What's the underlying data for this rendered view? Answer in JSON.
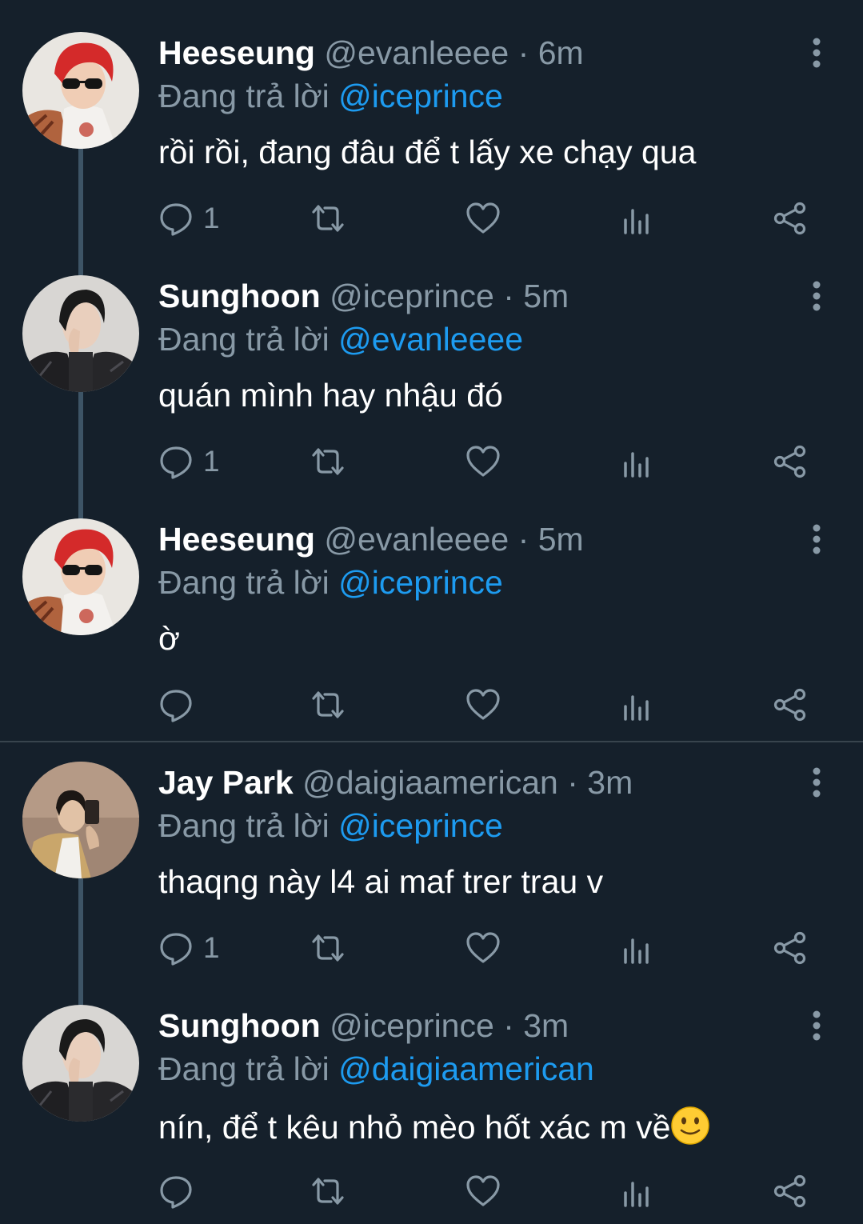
{
  "tweets": [
    {
      "name": "Heeseung",
      "handle": "@evanleeee",
      "separator": "·",
      "time": "6m",
      "reply_prefix": "Đang trả lời",
      "reply_to": "@iceprince",
      "text": "rồi rồi, đang đâu để t lấy xe chạy qua",
      "reply_count": "1",
      "avatar": "red-hair-sunglasses-avatar"
    },
    {
      "name": "Sunghoon",
      "handle": "@iceprince",
      "separator": "·",
      "time": "5m",
      "reply_prefix": "Đang trả lời",
      "reply_to": "@evanleeee",
      "text": "quán mình hay nhậu đó",
      "reply_count": "1",
      "avatar": "dark-hair-leather-jacket-avatar"
    },
    {
      "name": "Heeseung",
      "handle": "@evanleeee",
      "separator": "·",
      "time": "5m",
      "reply_prefix": "Đang trả lời",
      "reply_to": "@iceprince",
      "text": "ờ",
      "reply_count": "",
      "avatar": "red-hair-sunglasses-avatar"
    },
    {
      "name": "Jay Park",
      "handle": "@daigiaamerican",
      "separator": "·",
      "time": "3m",
      "reply_prefix": "Đang trả lời",
      "reply_to": "@iceprince",
      "text": "thaqng này l4 ai maf trer trau v",
      "reply_count": "1",
      "avatar": "phone-selfie-beige-jacket-avatar"
    },
    {
      "name": "Sunghoon",
      "handle": "@iceprince",
      "separator": "·",
      "time": "3m",
      "reply_prefix": "Đang trả lời",
      "reply_to": "@daigiaamerican",
      "text": "nín, để t kêu nhỏ mèo hốt xác m về",
      "reply_count": "",
      "avatar": "dark-hair-leather-jacket-avatar",
      "trailing_emoji": "slightly-smiling-face-emoji"
    }
  ],
  "icons": {
    "reply": "reply-icon",
    "retweet": "retweet-icon",
    "like": "heart-icon",
    "views": "views-icon",
    "share": "share-icon",
    "more": "more-vertical-icon"
  },
  "colors": {
    "background": "#15202b",
    "text": "#ffffff",
    "muted": "#8899a6",
    "mention": "#1d9bf0",
    "thread_line": "#3d5466",
    "divider": "#38444d"
  }
}
